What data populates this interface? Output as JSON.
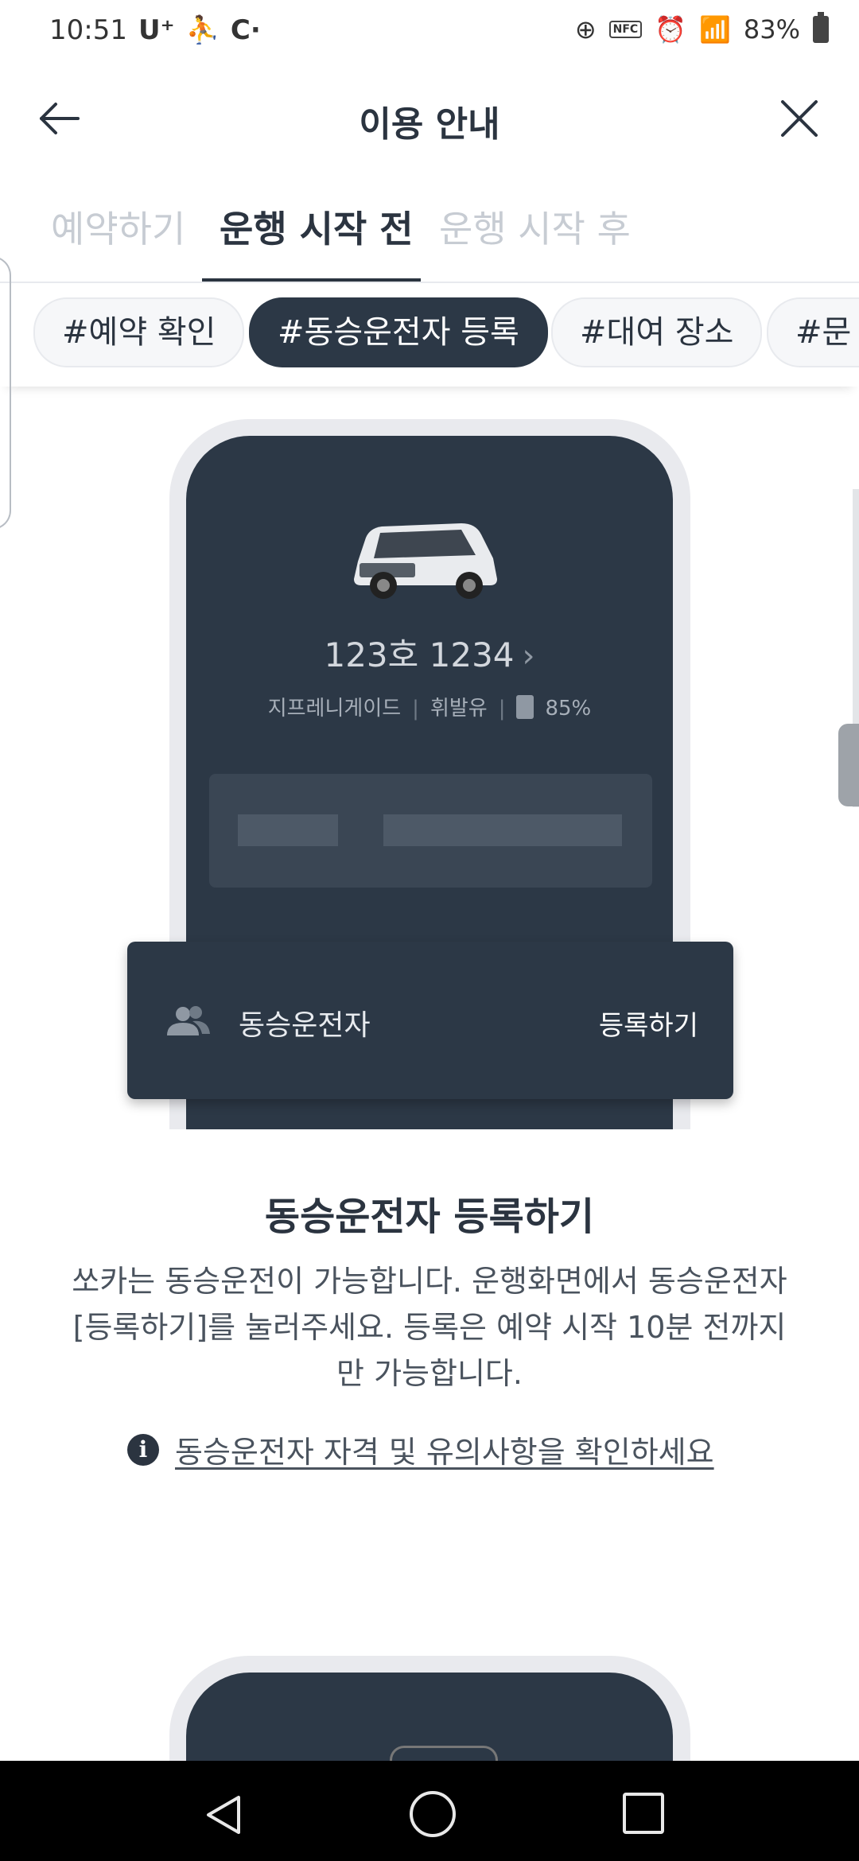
{
  "status_bar": {
    "time": "10:51",
    "carrier": "U⁺",
    "battery": "83%",
    "nfc_label": "NFC"
  },
  "header": {
    "title": "이용 안내",
    "back_icon": "arrow-left-icon",
    "close_icon": "close-icon"
  },
  "tabs": [
    {
      "label": "예약하기",
      "active": false
    },
    {
      "label": "운행 시작 전",
      "active": true
    },
    {
      "label": "운행 시작 후",
      "active": false
    }
  ],
  "chips": [
    {
      "label": "#예약 확인",
      "active": false
    },
    {
      "label": "#동승운전자 등록",
      "active": true
    },
    {
      "label": "#대여 장소",
      "active": false
    },
    {
      "label": "#문 열",
      "active": false
    }
  ],
  "mockup": {
    "plate": "123호 1234",
    "model": "지프레니게이드",
    "fuel_type": "휘발유",
    "fuel_level": "85%",
    "card_label": "동승운전자",
    "card_action": "등록하기",
    "card_icon": "people-icon"
  },
  "section": {
    "title": "동승운전자 등록하기",
    "body": "쏘카는 동승운전이 가능합니다. 운행화면에서 동승운전자 [등록하기]를 눌러주세요. 등록은 예약 시작 10분 전까지만 가능합니다.",
    "notice_link": "동승운전자 자격 및 유의사항을 확인하세요",
    "notice_icon": "info-icon"
  },
  "colors": {
    "primary_dark": "#2c3846",
    "text": "#2b3440",
    "tab_inactive": "#c7ccd3"
  }
}
